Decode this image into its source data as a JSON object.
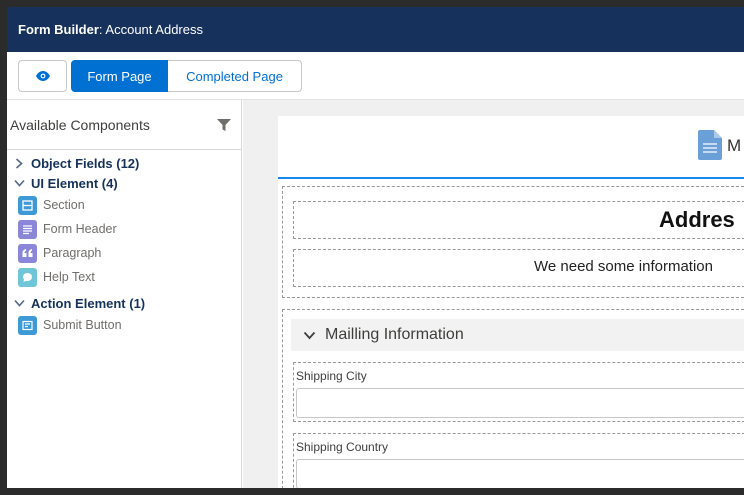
{
  "header": {
    "app_name": "Form Builder",
    "separator": ": ",
    "record_name": "Account Address"
  },
  "toolbar": {
    "preview_icon": "eye-icon",
    "tabs": [
      {
        "label": "Form Page",
        "active": true
      },
      {
        "label": "Completed Page",
        "active": false
      }
    ]
  },
  "sidebar": {
    "title": "Available Components",
    "filter_icon": "filter-icon",
    "groups": [
      {
        "label": "Object Fields (12)",
        "expanded": false,
        "items": []
      },
      {
        "label": "UI Element (4)",
        "expanded": true,
        "items": [
          {
            "label": "Section",
            "icon": "section-icon",
            "color": "#3e9ad6"
          },
          {
            "label": "Form Header",
            "icon": "form-header-icon",
            "color": "#8b86d8"
          },
          {
            "label": "Paragraph",
            "icon": "paragraph-icon",
            "color": "#8b86d8"
          },
          {
            "label": "Help Text",
            "icon": "help-text-icon",
            "color": "#6fc6d6"
          }
        ]
      },
      {
        "label": "Action Element (1)",
        "expanded": true,
        "items": [
          {
            "label": "Submit Button",
            "icon": "submit-button-icon",
            "color": "#3e9ad6"
          }
        ]
      }
    ]
  },
  "canvas": {
    "page_label_partial": "M",
    "doc_icon": "document-icon",
    "form_header": "Addres",
    "paragraph": "We need some information",
    "section": {
      "title": "Mailling Information",
      "chevron": "chevron-down-icon"
    },
    "fields": [
      {
        "label": "Shipping City",
        "value": ""
      },
      {
        "label": "Shipping Country",
        "value": ""
      }
    ]
  },
  "colors": {
    "header_bg": "#16325c",
    "accent": "#0070d2",
    "page_tab_underline": "#1589ee"
  }
}
